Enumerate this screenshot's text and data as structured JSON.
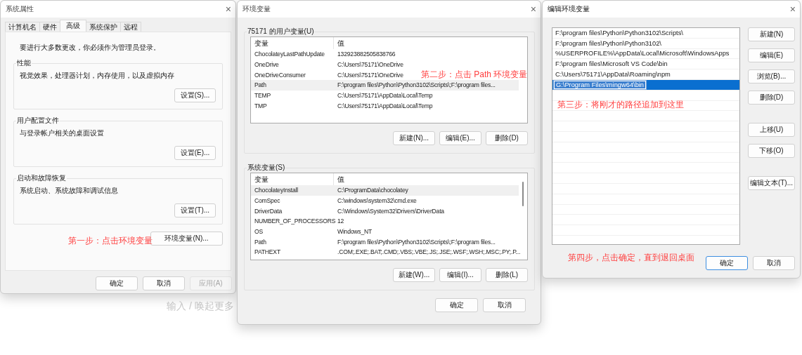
{
  "desktop": {
    "hint": "输入 / 唤起更多"
  },
  "system_properties": {
    "title": "系统属性",
    "close": "×",
    "tabs": [
      {
        "label": "计算机名",
        "selected": false
      },
      {
        "label": "硬件",
        "selected": false
      },
      {
        "label": "高级",
        "selected": true
      },
      {
        "label": "系统保护",
        "selected": false
      },
      {
        "label": "远程",
        "selected": false
      }
    ],
    "notice": "要进行大多数更改，你必须作为管理员登录。",
    "groups": [
      {
        "title": "性能",
        "description": "视觉效果，处理器计划，内存使用，以及虚拟内存",
        "button": "设置(S)..."
      },
      {
        "title": "用户配置文件",
        "description": "与登录帐户相关的桌面设置",
        "button": "设置(E)..."
      },
      {
        "title": "启动和故障恢复",
        "description": "系统启动、系统故障和调试信息",
        "button": "设置(T)..."
      }
    ],
    "annotation": "第一步：点击环境变量",
    "env_button": "环境变量(N)...",
    "buttons": [
      {
        "label": "确定",
        "disabled": false
      },
      {
        "label": "取消",
        "disabled": false
      },
      {
        "label": "应用(A)",
        "disabled": true
      }
    ]
  },
  "env_vars": {
    "title": "环境变量",
    "close": "×",
    "user_group": {
      "title": "75171 的用户变量(U)",
      "columns": [
        "变量",
        "值"
      ],
      "rows": [
        {
          "name": "ChocolateyLastPathUpdate",
          "value": "132923882505838766",
          "selected": false
        },
        {
          "name": "OneDrive",
          "value": "C:\\Users\\75171\\OneDrive",
          "selected": false
        },
        {
          "name": "OneDriveConsumer",
          "value": "C:\\Users\\75171\\OneDrive",
          "selected": false
        },
        {
          "name": "Path",
          "value": "F:\\program files\\Python\\Python3102\\Scripts\\;F:\\program files...",
          "selected": true
        },
        {
          "name": "TEMP",
          "value": "C:\\Users\\75171\\AppData\\Local\\Temp",
          "selected": false
        },
        {
          "name": "TMP",
          "value": "C:\\Users\\75171\\AppData\\Local\\Temp",
          "selected": false
        }
      ],
      "buttons": [
        "新建(N)...",
        "编辑(E)...",
        "删除(D)"
      ]
    },
    "annotation": "第二步：点击 Path 环境变量",
    "system_group": {
      "title": "系统变量(S)",
      "columns": [
        "变量",
        "值"
      ],
      "rows": [
        {
          "name": "ChocolateyInstall",
          "value": "C:\\ProgramData\\chocolatey",
          "selected": true
        },
        {
          "name": "ComSpec",
          "value": "C:\\windows\\system32\\cmd.exe",
          "selected": false
        },
        {
          "name": "DriverData",
          "value": "C:\\Windows\\System32\\Drivers\\DriverData",
          "selected": false
        },
        {
          "name": "NUMBER_OF_PROCESSORS",
          "value": "12",
          "selected": false
        },
        {
          "name": "OS",
          "value": "Windows_NT",
          "selected": false
        },
        {
          "name": "Path",
          "value": "F:\\program files\\Python\\Python3102\\Scripts\\;F:\\program files...",
          "selected": false
        },
        {
          "name": "PATHEXT",
          "value": ".COM;.EXE;.BAT;.CMD;.VBS;.VBE;.JS;.JSE;.WSF;.WSH;.MSC;.PY;.P...",
          "selected": false
        }
      ],
      "buttons": [
        "新建(W)...",
        "编辑(I)...",
        "删除(L)"
      ]
    },
    "buttons": [
      "确定",
      "取消"
    ]
  },
  "edit_env": {
    "title": "编辑环境变量",
    "close": "×",
    "entries": [
      {
        "text": "F:\\program files\\Python\\Python3102\\Scripts\\",
        "selected": false
      },
      {
        "text": "F:\\program files\\Python\\Python3102\\",
        "selected": false
      },
      {
        "text": "%USERPROFILE%\\AppData\\Local\\Microsoft\\WindowsApps",
        "selected": false
      },
      {
        "text": "F:\\program files\\Microsoft VS Code\\bin",
        "selected": false
      },
      {
        "text": "C:\\Users\\75171\\AppData\\Roaming\\npm",
        "selected": false
      },
      {
        "text": "G:\\Program Files\\mingw64\\bin",
        "selected": true
      }
    ],
    "annotation": "第三步：将刚才的路径追加到这里",
    "side_button_groups": [
      [
        "新建(N)",
        "编辑(E)",
        "浏览(B)...",
        "删除(D)"
      ],
      [
        "上移(U)",
        "下移(O)"
      ],
      [
        "编辑文本(T)..."
      ]
    ],
    "footer_annotation": "第四步，点击确定，直到退回桌面",
    "buttons": [
      {
        "label": "确定",
        "default": true
      },
      {
        "label": "取消",
        "default": false
      }
    ]
  }
}
